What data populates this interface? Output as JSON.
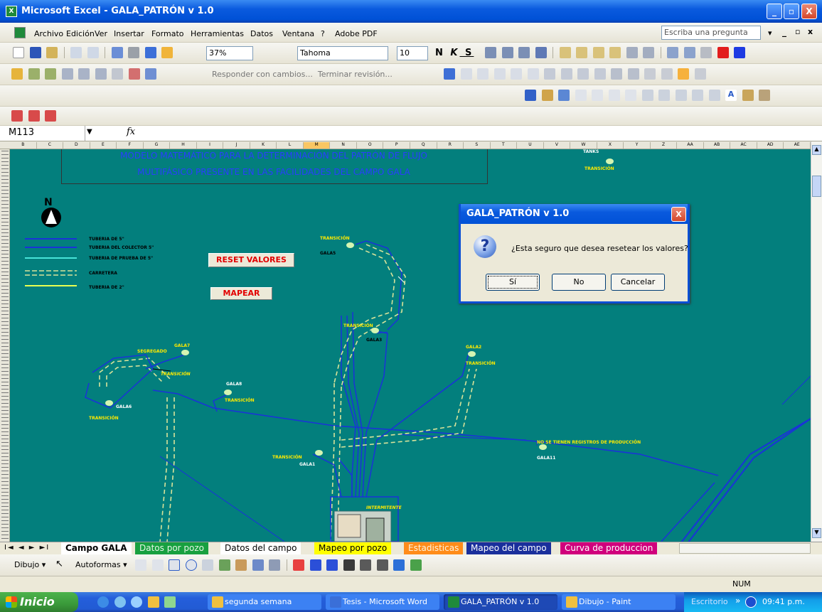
{
  "window": {
    "title": "Microsoft Excel - GALA_PATRÓN v 1.0",
    "buttons": {
      "minimize": "_",
      "maximize": "▫",
      "close": "X"
    }
  },
  "menu": {
    "items": [
      "Archivo",
      "Edición",
      "Ver",
      "Insertar",
      "Formato",
      "Herramientas",
      "Datos",
      "Ventana",
      "?",
      "Adobe PDF"
    ],
    "ask_placeholder": "Escriba una pregunta"
  },
  "toolbar": {
    "zoom": "37%",
    "font": "Tahoma",
    "font_size": "10",
    "review_reply": "Responder con cambios...",
    "review_end": "Terminar revisión..."
  },
  "formula_bar": {
    "name_box": "M113",
    "fx": "fx",
    "value": ""
  },
  "columns": [
    "B",
    "C",
    "D",
    "E",
    "F",
    "G",
    "H",
    "I",
    "J",
    "K",
    "L",
    "M",
    "N",
    "O",
    "P",
    "Q",
    "R",
    "S",
    "T",
    "U",
    "V",
    "W",
    "X",
    "Y",
    "Z",
    "AA",
    "AB",
    "AC",
    "AD",
    "AE"
  ],
  "sheet": {
    "title_line1": "MODELO MATEMÁTICO PARA LA DETERMINACIÓN DEL PATRÓN DE FLUJO",
    "title_line2": "MULTIFÁSICO PRESENTE EN LAS FACILIDADES DEL CAMPO GALA",
    "north": "N",
    "legend": [
      "TUBERIA DE 5\"",
      "TUBERIA DEL COLECTOR 5\"",
      "TUBERIA DE PRUEBA DE 5\"",
      "CARRETERA",
      "TUBERIA DE 2\""
    ],
    "reset_button": "RESET VALORES",
    "map_button": "MAPEAR",
    "labels": {
      "transicion": "TRANSICIÓN",
      "segregado": "SEGREGADO",
      "intermitente": "INTERMITENTE",
      "no_registros": "NO SE TIENEN REGISTROS DE PRODUCCIÓN",
      "tanks": "TANKS",
      "gala3": "GALA3",
      "gala5": "GALA5",
      "gala6": "GALA6",
      "gala7": "GALA7",
      "gala8": "GALA8",
      "gala1": "GALA1",
      "gala2": "GALA2",
      "gala11": "GALA11"
    }
  },
  "dialog": {
    "title": "GALA_PATRÓN v 1.0",
    "close": "X",
    "icon": "question-icon",
    "question_mark": "?",
    "message": "¿Esta seguro que desea resetear los valores?",
    "yes": "Sí",
    "no": "No",
    "cancel": "Cancelar"
  },
  "tabs": [
    "Campo GALA",
    "Datos por pozo",
    "Datos del campo",
    "Mapeo por pozo",
    "Estadisticas",
    "Mapeo del campo",
    "Curva de produccion"
  ],
  "tab_nav": [
    "I◄",
    "◄",
    "►",
    "►I"
  ],
  "tab_colors": [
    "#ffffff",
    "#18a040",
    "#ffffff",
    "#ffff00",
    "#ff8c1a",
    "#1a2f9c",
    "#d0007c"
  ],
  "drawing": {
    "dibujo": "Dibujo ▾",
    "autoformas": "Autoformas ▾"
  },
  "status": {
    "num": "NUM"
  },
  "taskbar": {
    "start": "Inicio",
    "tasks": [
      "segunda semana",
      "Tesis - Microsoft Word",
      "GALA_PATRÓN v 1.0",
      "Dibujo - Paint"
    ],
    "desktop": "Escritorio",
    "chevron": "»",
    "time": "09:41 p.m."
  }
}
